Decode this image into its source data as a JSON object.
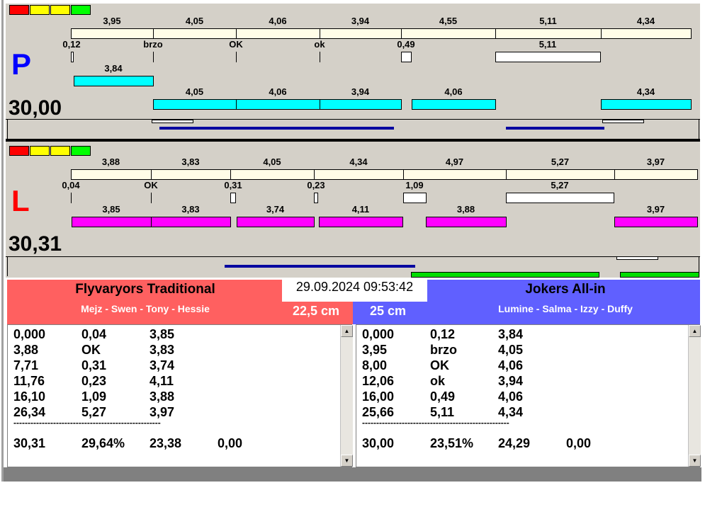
{
  "colors": {
    "indicator": [
      "#ff0000",
      "#ffff00",
      "#ffff00",
      "#00ff00"
    ],
    "team1": "#ff6060",
    "team2": "#6060ff",
    "cyan": "#00ffff",
    "magenta": "#ff00ff",
    "blue_line": "#0000a0",
    "green_line": "#00dd00"
  },
  "p": {
    "letter": "P",
    "total": "30,00",
    "top_labels": [
      "3,95",
      "4,05",
      "4,06",
      "3,94",
      "4,55",
      "5,11",
      "4,34"
    ],
    "sub_labels": [
      "0,12",
      "brzo",
      "OK",
      "ok",
      "0,49",
      "5,11"
    ],
    "row1_labels": [
      "3,84"
    ],
    "row2_labels": [
      "4,05",
      "4,06",
      "3,94",
      "4,06",
      "4,34"
    ]
  },
  "l": {
    "letter": "L",
    "total": "30,31",
    "top_labels": [
      "3,88",
      "3,83",
      "4,05",
      "4,34",
      "4,97",
      "5,27",
      "3,97"
    ],
    "sub_labels": [
      "0,04",
      "OK",
      "0,31",
      "0,23",
      "1,09",
      "5,27"
    ],
    "row_labels": [
      "3,85",
      "3,83",
      "3,74",
      "4,11",
      "3,88",
      "3,97"
    ]
  },
  "datetime": "29.09.2024 09:53:42",
  "team1": {
    "name": "Flyvaryors Traditional",
    "players": "Mejz - Swen - Tony - Hessie",
    "distance": "22,5 cm",
    "rows": [
      [
        "0,000",
        "0,04",
        "3,85"
      ],
      [
        "3,88",
        "OK",
        "3,83"
      ],
      [
        "7,71",
        "0,31",
        "3,74"
      ],
      [
        "11,76",
        "0,23",
        "4,11"
      ],
      [
        "16,10",
        "1,09",
        "3,88"
      ],
      [
        "26,34",
        "5,27",
        "3,97"
      ]
    ],
    "separator": "----------------------------------------------------",
    "summary": [
      "30,31",
      "29,64%",
      "23,38",
      "0,00"
    ]
  },
  "team2": {
    "name": "Jokers All-in",
    "players": "Lumine - Salma - Izzy - Duffy",
    "distance": "25 cm",
    "rows": [
      [
        "0,000",
        "0,12",
        "3,84"
      ],
      [
        "3,95",
        "brzo",
        "4,05"
      ],
      [
        "8,00",
        "OK",
        "4,06"
      ],
      [
        "12,06",
        "ok",
        "3,94"
      ],
      [
        "16,00",
        "0,49",
        "4,06"
      ],
      [
        "25,66",
        "5,11",
        "4,34"
      ]
    ],
    "separator": "----------------------------------------------------",
    "summary": [
      "30,00",
      "23,51%",
      "24,29",
      "0,00"
    ]
  }
}
